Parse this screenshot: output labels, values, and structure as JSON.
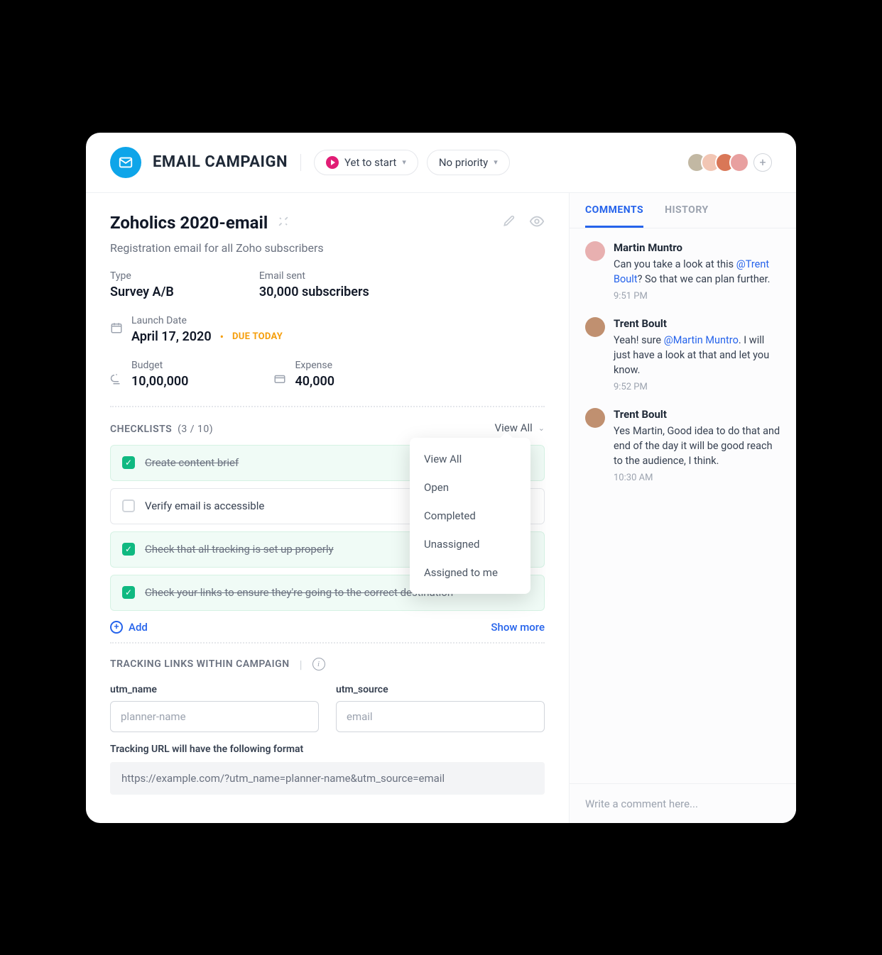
{
  "header": {
    "app_title": "EMAIL CAMPAIGN",
    "status_label": "Yet to start",
    "priority_label": "No priority",
    "avatars": [
      "#c2b8a3",
      "#f2c6b4",
      "#d97757",
      "#e8a0a0"
    ]
  },
  "page": {
    "title": "Zoholics 2020-email",
    "subtitle": "Registration email for all Zoho subscribers",
    "type_label": "Type",
    "type_value": "Survey A/B",
    "sent_label": "Email sent",
    "sent_value": "30,000 subscribers",
    "launch_label": "Launch Date",
    "launch_value": "April 17, 2020",
    "due_badge": "DUE TODAY",
    "budget_label": "Budget",
    "budget_value": "10,00,000",
    "expense_label": "Expense",
    "expense_value": "40,000"
  },
  "checklists": {
    "section_label": "CHECKLISTS",
    "count": "(3 / 10)",
    "view_all_label": "View All",
    "items": [
      {
        "text": "Create content brief",
        "done": true
      },
      {
        "text": "Verify email is accessible",
        "done": false
      },
      {
        "text": "Check that all tracking is set up properly",
        "done": true
      },
      {
        "text": "Check your links to ensure they're going to the correct destination",
        "done": true
      }
    ],
    "add_label": "Add",
    "show_more": "Show more",
    "filter_options": [
      "View All",
      "Open",
      "Completed",
      "Unassigned",
      "Assigned to me"
    ]
  },
  "tracking": {
    "section_label": "TRACKING LINKS WITHIN CAMPAIGN",
    "utm_name_label": "utm_name",
    "utm_name_placeholder": "planner-name",
    "utm_source_label": "utm_source",
    "utm_source_placeholder": "email",
    "url_label": "Tracking URL will have the following format",
    "url_value": "https://example.com/?utm_name=planner-name&utm_source=email"
  },
  "side": {
    "tab_comments": "COMMENTS",
    "tab_history": "HISTORY",
    "comments": [
      {
        "author": "Martin Muntro",
        "pre": "Can you take a look at this ",
        "mention": "@Trent Boult",
        "post": "? So that we can plan further.",
        "time": "9:51 PM",
        "avatar": "#e8b0b0"
      },
      {
        "author": "Trent Boult",
        "pre": "Yeah! sure ",
        "mention": "@Martin Muntro",
        "post": ". I will just have a look at that and let you know.",
        "time": "9:52 PM",
        "avatar": "#c09070"
      },
      {
        "author": "Trent Boult",
        "pre": "Yes Martin, Good idea to do that and end of the day it will be good reach to the audience, I think.",
        "mention": "",
        "post": "",
        "time": "10:30 AM",
        "avatar": "#c09070"
      }
    ],
    "compose_placeholder": "Write a comment here..."
  }
}
